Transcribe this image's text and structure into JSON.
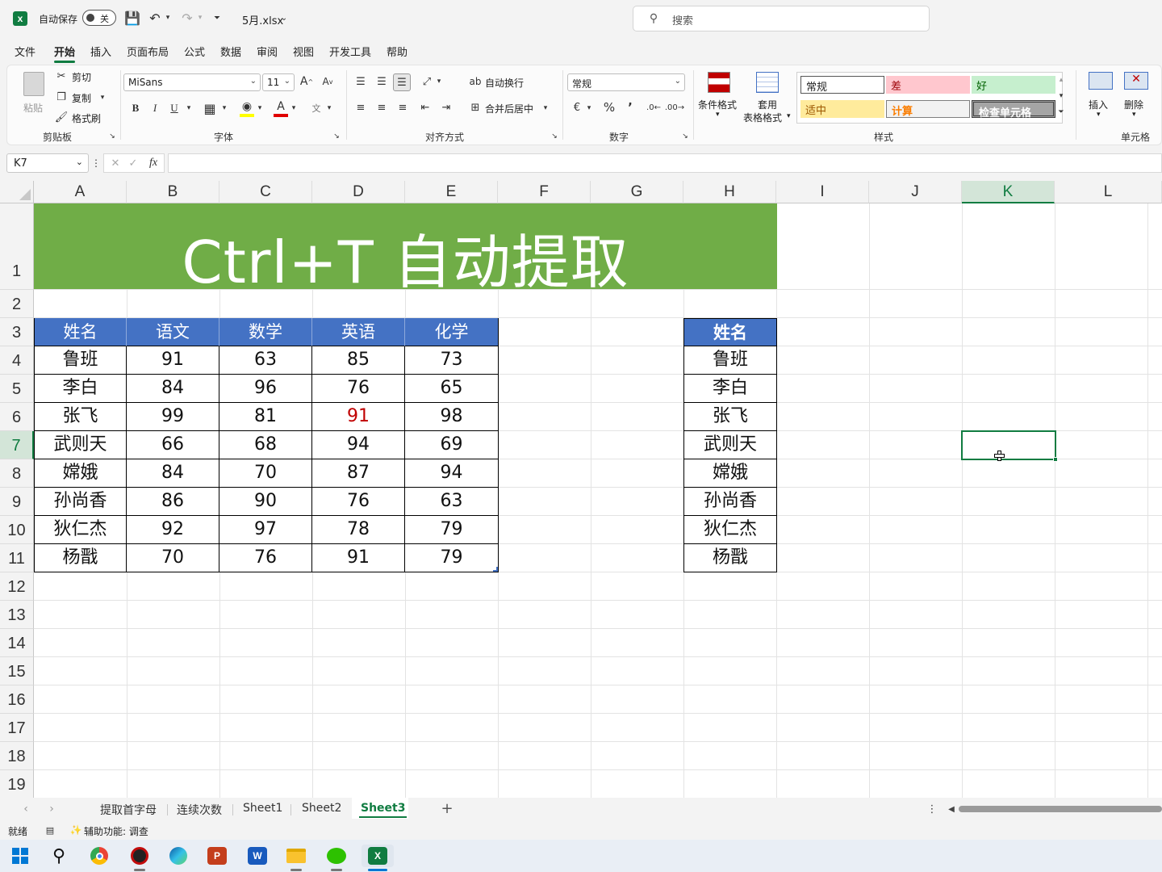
{
  "titlebar": {
    "autosave_label": "自动保存",
    "autosave_state": "关",
    "filename": "5月.xlsx",
    "search_placeholder": "搜索"
  },
  "menu": [
    "文件",
    "开始",
    "插入",
    "页面布局",
    "公式",
    "数据",
    "审阅",
    "视图",
    "开发工具",
    "帮助"
  ],
  "menu_active": "开始",
  "ribbon": {
    "paste": "粘贴",
    "cut": "剪切",
    "copy": "复制",
    "format_painter": "格式刷",
    "clipboard": "剪贴板",
    "font_name": "MiSans",
    "font_size": "11",
    "font_group": "字体",
    "wrap_text": "自动换行",
    "merge_center": "合并后居中",
    "align_group": "对齐方式",
    "number_format": "常规",
    "number_group": "数字",
    "cond_format": "条件格式",
    "table_format_1": "套用",
    "table_format_2": "表格格式",
    "styles": {
      "normal": "常规",
      "bad": "差",
      "good": "好",
      "neutral": "适中",
      "calc": "计算",
      "check": "检查单元格"
    },
    "styles_group": "样式",
    "insert": "插入",
    "delete": "删除",
    "cells_group": "单元格"
  },
  "formula_bar": {
    "name_box": "K7",
    "fx": "fx",
    "value": ""
  },
  "columns": [
    "A",
    "B",
    "C",
    "D",
    "E",
    "F",
    "G",
    "H",
    "I",
    "J",
    "K",
    "L"
  ],
  "rows": [
    "1",
    "2",
    "3",
    "4",
    "5",
    "6",
    "7",
    "8",
    "9",
    "10",
    "11",
    "12",
    "13",
    "14",
    "15",
    "16",
    "17",
    "18",
    "19"
  ],
  "selected_cell": "K7",
  "banner_title": "Ctrl+T 自动提取",
  "table": {
    "headers": [
      "姓名",
      "语文",
      "数学",
      "英语",
      "化学"
    ],
    "rows": [
      [
        "鲁班",
        "91",
        "63",
        "85",
        "73"
      ],
      [
        "李白",
        "84",
        "96",
        "76",
        "65"
      ],
      [
        "张飞",
        "99",
        "81",
        "91",
        "98"
      ],
      [
        "武则天",
        "66",
        "68",
        "94",
        "69"
      ],
      [
        "嫦娥",
        "84",
        "70",
        "87",
        "94"
      ],
      [
        "孙尚香",
        "86",
        "90",
        "76",
        "63"
      ],
      [
        "狄仁杰",
        "92",
        "97",
        "78",
        "79"
      ],
      [
        "杨戬",
        "70",
        "76",
        "91",
        "79"
      ]
    ]
  },
  "name_list": {
    "header": "姓名",
    "items": [
      "鲁班",
      "李白",
      "张飞",
      "武则天",
      "嫦娥",
      "孙尚香",
      "狄仁杰",
      "杨戬"
    ]
  },
  "sheets": [
    "提取首字母",
    "连续次数",
    "Sheet1",
    "Sheet2",
    "Sheet3"
  ],
  "active_sheet": "Sheet3",
  "status": {
    "ready": "就绪",
    "accessibility": "辅助功能: 调查"
  },
  "colors": {
    "banner": "#70ad47",
    "header_fill": "#4472c4",
    "accent": "#107c41",
    "highlight_red": "#c00000"
  },
  "taskbar": [
    "windows-start",
    "search",
    "chrome",
    "app-netease",
    "edge",
    "powerpoint",
    "word",
    "file-explorer",
    "wechat",
    "excel"
  ]
}
